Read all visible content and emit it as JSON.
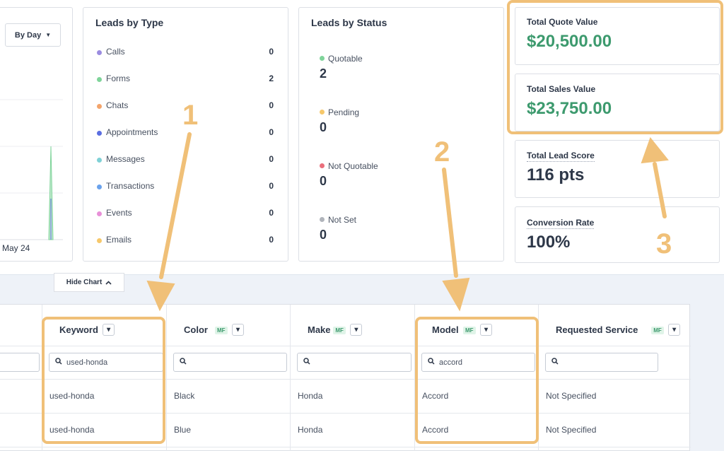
{
  "chart_panel": {
    "range_button": "By Day",
    "x_tick": "May 24"
  },
  "leads_by_type": {
    "title": "Leads by Type",
    "items": [
      {
        "label": "Calls",
        "value": "0",
        "color": "#9b8ce0"
      },
      {
        "label": "Forms",
        "value": "2",
        "color": "#7fd49a"
      },
      {
        "label": "Chats",
        "value": "0",
        "color": "#f3a46b"
      },
      {
        "label": "Appointments",
        "value": "0",
        "color": "#5b6ee1"
      },
      {
        "label": "Messages",
        "value": "0",
        "color": "#7fd1d6"
      },
      {
        "label": "Transactions",
        "value": "0",
        "color": "#6aa2ec"
      },
      {
        "label": "Events",
        "value": "0",
        "color": "#e890d8"
      },
      {
        "label": "Emails",
        "value": "0",
        "color": "#f6c86b"
      }
    ]
  },
  "leads_by_status": {
    "title": "Leads by Status",
    "items": [
      {
        "label": "Quotable",
        "value": "2",
        "color": "#7fd49a"
      },
      {
        "label": "Pending",
        "value": "0",
        "color": "#f6c86b"
      },
      {
        "label": "Not Quotable",
        "value": "0",
        "color": "#ea6f7c"
      },
      {
        "label": "Not Set",
        "value": "0",
        "color": "#b0b4bb"
      }
    ]
  },
  "metrics": {
    "quote_label": "Total Quote Value",
    "quote_value": "$20,500.00",
    "sales_label": "Total Sales Value",
    "sales_value": "$23,750.00",
    "score_label": "Total Lead Score",
    "score_value": "116 pts",
    "conversion_label": "Conversion Rate",
    "conversion_value": "100%"
  },
  "annotations": {
    "one": "1",
    "two": "2",
    "three": "3"
  },
  "hide_chart": "Hide Chart",
  "table": {
    "columns": [
      {
        "label": "Keyword",
        "mf": "",
        "search": "used-honda"
      },
      {
        "label": "Color",
        "mf": "MF",
        "search": ""
      },
      {
        "label": "Make",
        "mf": "MF",
        "search": ""
      },
      {
        "label": "Model",
        "mf": "MF",
        "search": "accord"
      },
      {
        "label": "Requested Service",
        "mf": "MF",
        "search": ""
      }
    ],
    "rows": [
      [
        "used-honda",
        "Black",
        "Honda",
        "Accord",
        "Not Specified"
      ],
      [
        "used-honda",
        "Blue",
        "Honda",
        "Accord",
        "Not Specified"
      ]
    ]
  },
  "colors": {
    "accent_green": "#3d9a6e",
    "highlight": "#f0c078"
  }
}
